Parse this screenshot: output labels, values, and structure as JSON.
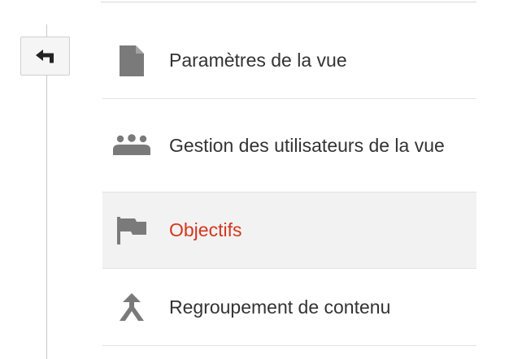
{
  "back_button": {
    "icon": "back-arrow-icon"
  },
  "menu": {
    "active_color": "#d5361f",
    "items": [
      {
        "label": "Paramètres de la vue",
        "icon": "document-icon",
        "active": false
      },
      {
        "label": "Gestion des utilisateurs de la vue",
        "icon": "users-icon",
        "active": false
      },
      {
        "label": "Objectifs",
        "icon": "flag-icon",
        "active": true
      },
      {
        "label": "Regroupement de contenu",
        "icon": "content-grouping-icon",
        "active": false
      }
    ]
  }
}
